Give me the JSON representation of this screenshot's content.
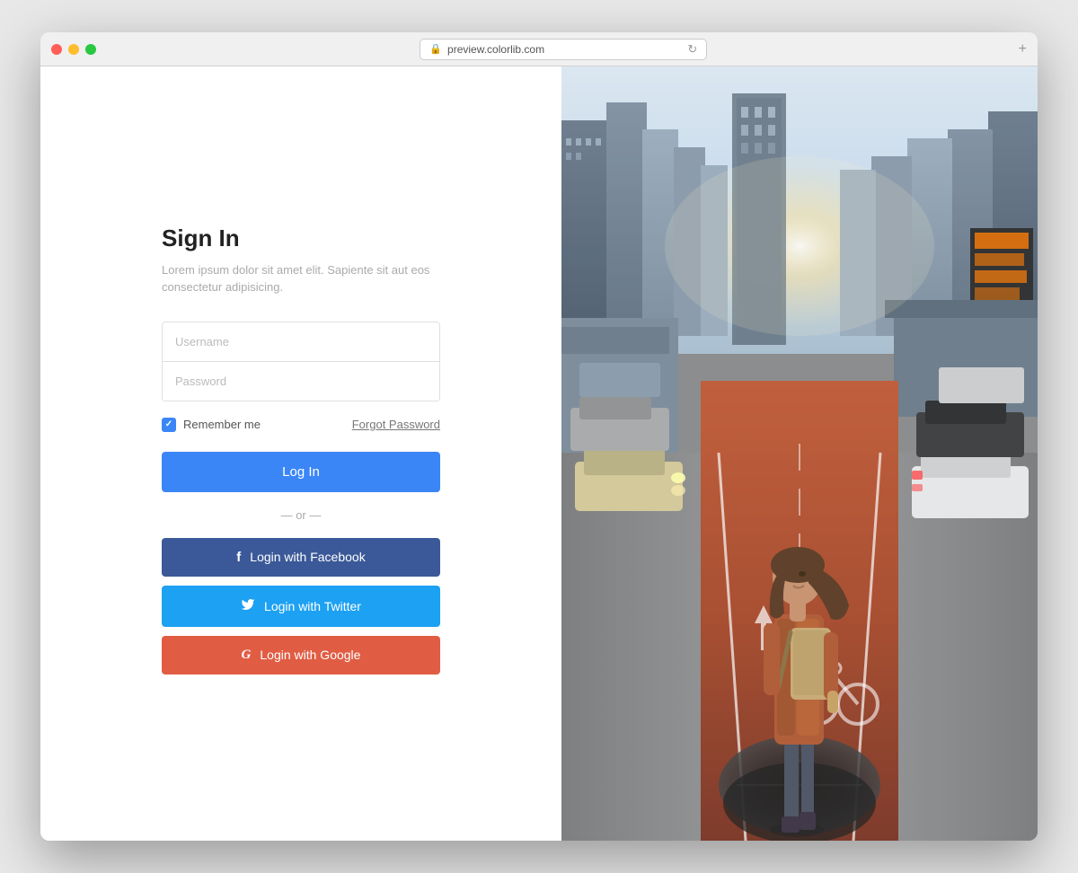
{
  "window": {
    "url": "preview.colorlib.com",
    "traffic_lights": [
      "red",
      "yellow",
      "green"
    ]
  },
  "form": {
    "title": "Sign In",
    "description": "Lorem ipsum dolor sit amet elit. Sapiente sit aut eos consectetur adipisicing.",
    "username_placeholder": "Username",
    "password_placeholder": "Password",
    "remember_me_label": "Remember me",
    "forgot_password_label": "Forgot Password",
    "login_button_label": "Log In",
    "divider_text": "— or —",
    "facebook_button_label": "Login with Facebook",
    "twitter_button_label": "Login with Twitter",
    "google_button_label": "Login with Google",
    "facebook_icon": "f",
    "twitter_icon": "𝕥",
    "google_icon": "G"
  },
  "colors": {
    "primary_blue": "#3b86f7",
    "facebook": "#3b5998",
    "twitter": "#1da1f2",
    "google": "#e05d44",
    "text_dark": "#222222",
    "text_light": "#aaaaaa",
    "border": "#e0e0e0"
  }
}
